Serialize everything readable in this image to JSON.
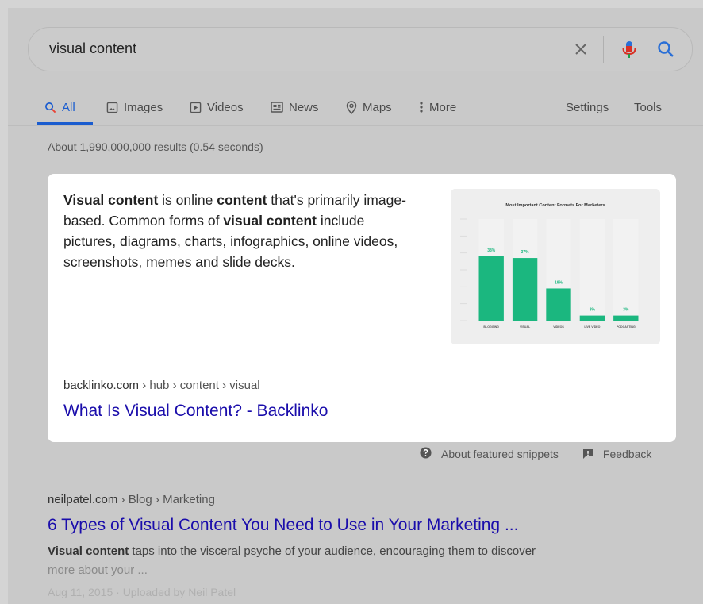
{
  "search": {
    "query": "visual content"
  },
  "tabs": [
    {
      "label": "All",
      "icon": "search-icon",
      "active": true
    },
    {
      "label": "Images",
      "icon": "image-icon"
    },
    {
      "label": "Videos",
      "icon": "video-icon"
    },
    {
      "label": "News",
      "icon": "news-icon"
    },
    {
      "label": "Maps",
      "icon": "map-pin-icon"
    },
    {
      "label": "More",
      "icon": "more-vert-icon"
    },
    {
      "label": "Settings"
    },
    {
      "label": "Tools"
    }
  ],
  "result_stats": "About 1,990,000,000 results (0.54 seconds)",
  "featured_snippet": {
    "segments": [
      {
        "t": "Visual content",
        "b": true
      },
      {
        "t": " is online ",
        "b": false
      },
      {
        "t": "content",
        "b": true
      },
      {
        "t": " that's primarily image-based. Common forms of ",
        "b": false
      },
      {
        "t": "visual content",
        "b": true
      },
      {
        "t": " include pictures, diagrams, charts, infographics, online videos, screenshots, memes and slide decks.",
        "b": false
      }
    ],
    "url_domain": "backlinko.com",
    "url_path": " › hub › content › visual",
    "title": "What Is Visual Content? - Backlinko",
    "about_label": "About featured snippets",
    "feedback_label": "Feedback"
  },
  "chart_data": {
    "type": "bar",
    "title": "Most Important Content Formats For Marketers",
    "categories": [
      "BLOGGING",
      "VISUAL",
      "VIDEOS",
      "LIVE VIDEO",
      "PODCASTING"
    ],
    "values": [
      38,
      37,
      19,
      3,
      3
    ],
    "value_labels": [
      "38%",
      "37%",
      "19%",
      "3%",
      "3%"
    ],
    "ylim": [
      0,
      60
    ],
    "colors": {
      "bar": "#1bb77f",
      "track": "#f2f2f2",
      "label": "#1bb77f"
    }
  },
  "result2": {
    "url_domain": "neilpatel.com",
    "url_path": " › Blog › Marketing",
    "title": "6 Types of Visual Content You Need to Use in Your Marketing ...",
    "snippet_bold": "Visual content",
    "snippet_rest": " taps into the visceral psyche of your audience, encouraging them to discover",
    "snippet_line2": "more about your ...",
    "meta": "Aug 11, 2015 · Uploaded by Neil Patel"
  },
  "colors": {
    "link": "#1a0dab",
    "active_tab": "#1a5ccf",
    "mic_red": "#d93025",
    "mic_blue": "#2a6fd6",
    "search_blue": "#2a6fd6"
  }
}
